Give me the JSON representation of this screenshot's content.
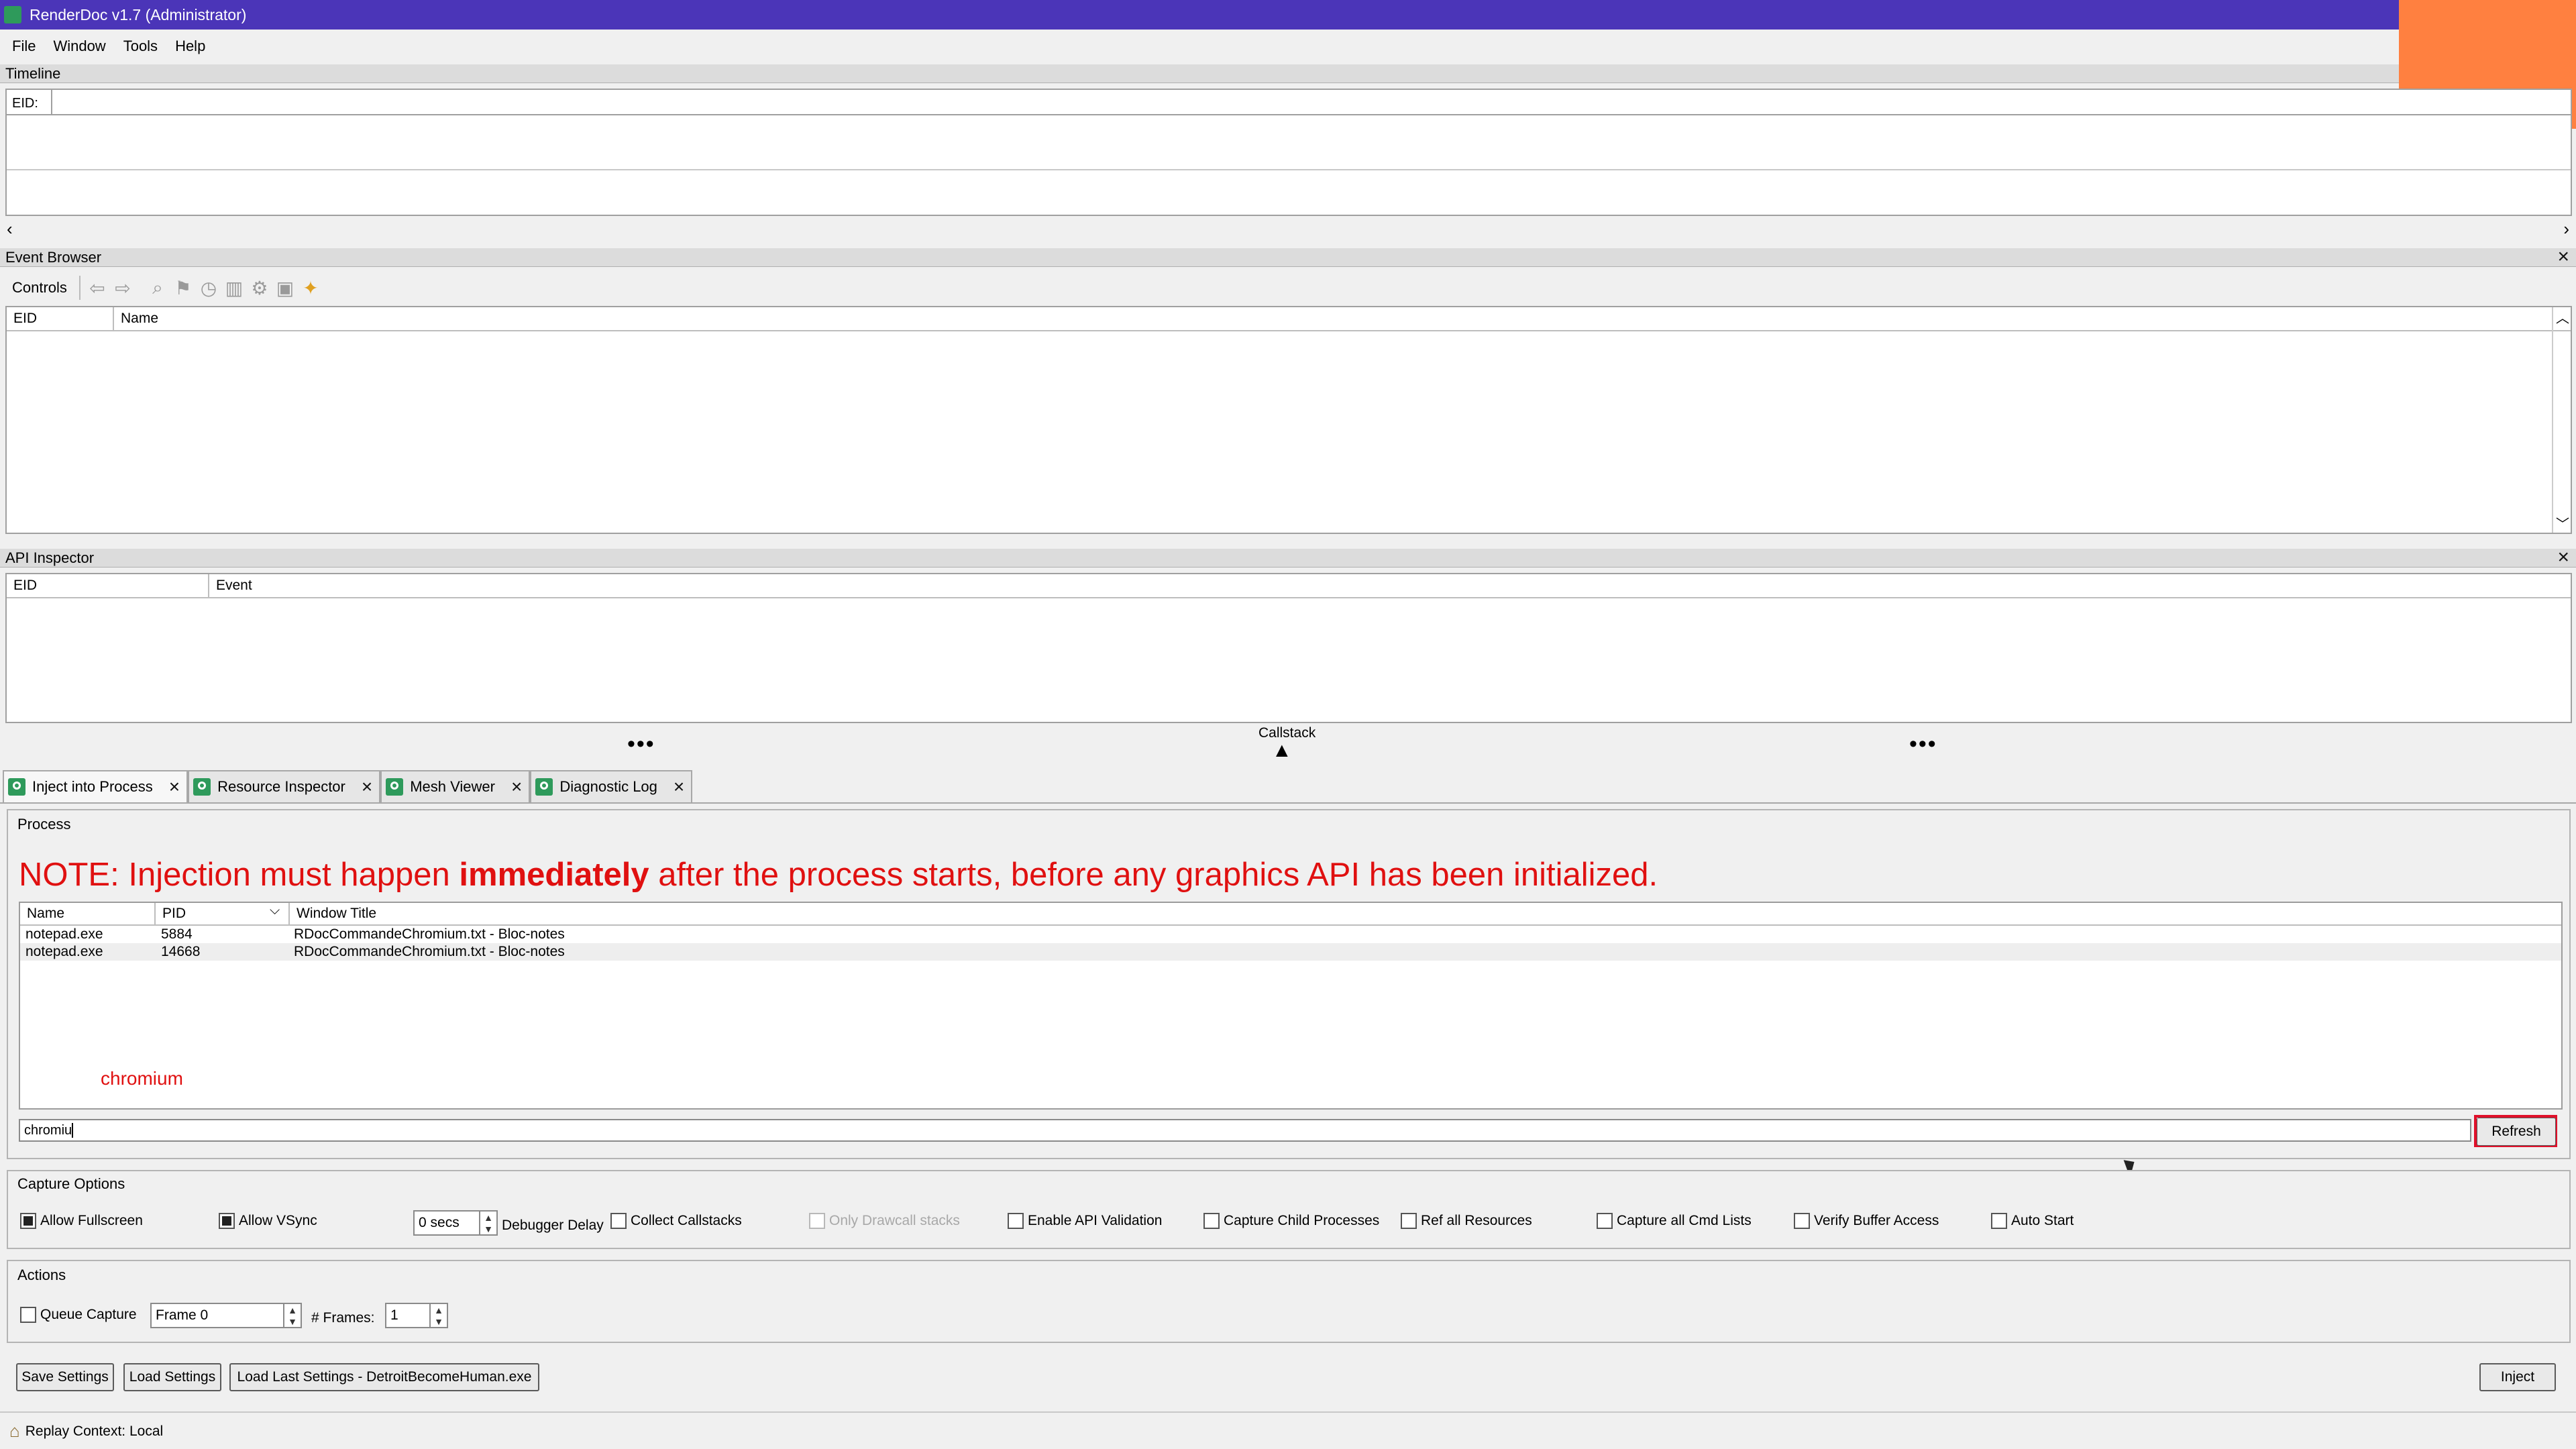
{
  "window": {
    "title": "RenderDoc v1.7 (Administrator)"
  },
  "menu": [
    "File",
    "Window",
    "Tools",
    "Help"
  ],
  "timeline": {
    "title": "Timeline",
    "eid_label": "EID:"
  },
  "event_browser": {
    "title": "Event Browser",
    "controls_label": "Controls",
    "columns": [
      "EID",
      "Name"
    ]
  },
  "api_inspector": {
    "title": "API Inspector",
    "columns": [
      "EID",
      "Event"
    ],
    "callstack_label": "Callstack"
  },
  "tabs": [
    {
      "label": "Inject into Process",
      "active": true
    },
    {
      "label": "Resource Inspector",
      "active": false
    },
    {
      "label": "Mesh Viewer",
      "active": false
    },
    {
      "label": "Diagnostic Log",
      "active": false
    }
  ],
  "process": {
    "group_title": "Process",
    "note_prefix": "NOTE: Injection must happen ",
    "note_bold": "immediately",
    "note_suffix": " after the process starts, before any graphics API has been initialized.",
    "columns": [
      "Name",
      "PID",
      "Window Title"
    ],
    "rows": [
      {
        "name": "notepad.exe",
        "pid": "5884",
        "title": "RDocCommandeChromium.txt - Bloc-notes"
      },
      {
        "name": "notepad.exe",
        "pid": "14668",
        "title": "RDocCommandeChromium.txt - Bloc-notes"
      }
    ],
    "overlay_text": "chromium",
    "filter_value": "chromiu",
    "refresh_label": "Refresh"
  },
  "capture_options": {
    "title": "Capture Options",
    "allow_fullscreen": "Allow Fullscreen",
    "allow_vsync": "Allow VSync",
    "delay_value": "0 secs",
    "debugger_delay": "Debugger Delay",
    "collect_callstacks": "Collect Callstacks",
    "only_drawcall": "Only Drawcall stacks",
    "enable_api_validation": "Enable API Validation",
    "capture_child": "Capture Child Processes",
    "ref_all": "Ref all Resources",
    "capture_cmd": "Capture all Cmd Lists",
    "verify_buffer": "Verify Buffer Access",
    "auto_start": "Auto Start"
  },
  "actions": {
    "title": "Actions",
    "queue_capture": "Queue Capture",
    "frame_value": "Frame 0",
    "frames_label": "# Frames:",
    "frames_value": "1"
  },
  "buttons": {
    "save_settings": "Save Settings",
    "load_settings": "Load Settings",
    "load_last": "Load Last Settings - DetroitBecomeHuman.exe",
    "inject": "Inject"
  },
  "status": {
    "replay_context": "Replay Context: Local"
  },
  "colors": {
    "titlebar": "#4b35b8",
    "accent_orange": "#ff8040",
    "note_red": "#e01010",
    "refresh_highlight": "#e0102a"
  }
}
